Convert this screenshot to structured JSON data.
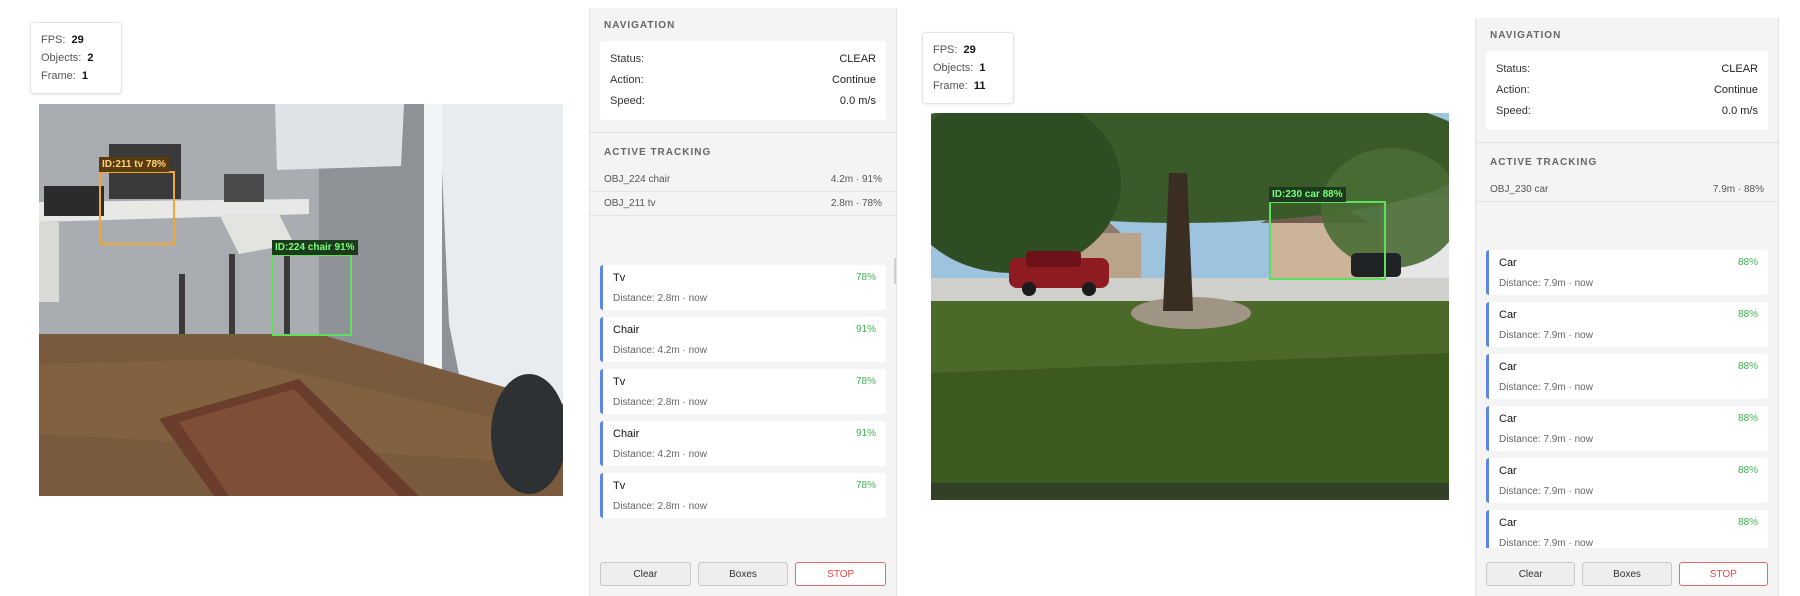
{
  "colors": {
    "accent_blue": "#5b86e5",
    "confidence_green": "#3fb34f",
    "stop_red": "#e04848",
    "box_orange": "#f0a830",
    "box_green": "#5ee05e"
  },
  "left": {
    "stats": {
      "fps_label": "FPS:",
      "fps": "29",
      "objects_label": "Objects:",
      "objects": "2",
      "frame_label": "Frame:",
      "frame": "1"
    },
    "detections": [
      {
        "label": "ID:211 tv 78%",
        "color": "#f0a830"
      },
      {
        "label": "ID:224 chair 91%",
        "color": "#5ee05e"
      }
    ],
    "panel": {
      "nav_title": "NAVIGATION",
      "status_label": "Status:",
      "status": "CLEAR",
      "action_label": "Action:",
      "action": "Continue",
      "speed_label": "Speed:",
      "speed": "0.0 m/s",
      "tracking_title": "ACTIVE TRACKING",
      "tracking": [
        {
          "name": "OBJ_224 chair",
          "value": "4.2m · 91%"
        },
        {
          "name": "OBJ_211 tv",
          "value": "2.8m · 78%"
        }
      ],
      "cards": [
        {
          "name": "Tv",
          "conf": "78%",
          "sub": "Distance: 2.8m · now"
        },
        {
          "name": "Chair",
          "conf": "91%",
          "sub": "Distance: 4.2m · now"
        },
        {
          "name": "Tv",
          "conf": "78%",
          "sub": "Distance: 2.8m · now"
        },
        {
          "name": "Chair",
          "conf": "91%",
          "sub": "Distance: 4.2m · now"
        },
        {
          "name": "Tv",
          "conf": "78%",
          "sub": "Distance: 2.8m · now"
        }
      ],
      "buttons": {
        "clear": "Clear",
        "boxes": "Boxes",
        "stop": "STOP"
      }
    }
  },
  "right": {
    "stats": {
      "fps_label": "FPS:",
      "fps": "29",
      "objects_label": "Objects:",
      "objects": "1",
      "frame_label": "Frame:",
      "frame": "11"
    },
    "detections": [
      {
        "label": "ID:230 car 88%",
        "color": "#5ee05e"
      }
    ],
    "panel": {
      "nav_title": "NAVIGATION",
      "status_label": "Status:",
      "status": "CLEAR",
      "action_label": "Action:",
      "action": "Continue",
      "speed_label": "Speed:",
      "speed": "0.0 m/s",
      "tracking_title": "ACTIVE TRACKING",
      "tracking": [
        {
          "name": "OBJ_230 car",
          "value": "7.9m · 88%"
        }
      ],
      "cards": [
        {
          "name": "Car",
          "conf": "88%",
          "sub": "Distance: 7.9m · now"
        },
        {
          "name": "Car",
          "conf": "88%",
          "sub": "Distance: 7.9m · now"
        },
        {
          "name": "Car",
          "conf": "88%",
          "sub": "Distance: 7.9m · now"
        },
        {
          "name": "Car",
          "conf": "88%",
          "sub": "Distance: 7.9m · now"
        },
        {
          "name": "Car",
          "conf": "88%",
          "sub": "Distance: 7.9m · now"
        },
        {
          "name": "Car",
          "conf": "88%",
          "sub": "Distance: 7.9m · now"
        }
      ],
      "buttons": {
        "clear": "Clear",
        "boxes": "Boxes",
        "stop": "STOP"
      }
    }
  }
}
